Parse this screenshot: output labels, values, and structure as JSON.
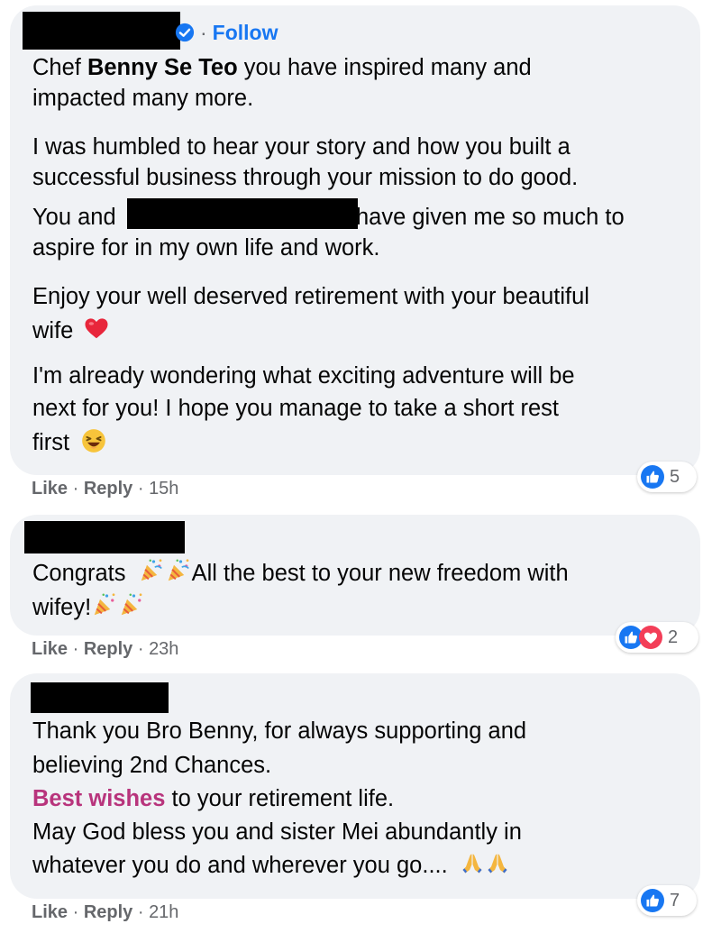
{
  "comments": [
    {
      "follow_label": "Follow",
      "lines": [
        {
          "pre": "Chef ",
          "bold": "Benny Se Teo",
          "post": " you have inspired many and"
        },
        {
          "text": "impacted many more."
        },
        {
          "text": "I was humbled to hear your story and how you built a"
        },
        {
          "text": "successful business through your mission to do good."
        },
        {
          "pre": "You and",
          "post": "have given me so much to"
        },
        {
          "text": "aspire for in my own life and work."
        },
        {
          "text": "Enjoy your well deserved retirement with your beautiful"
        },
        {
          "text": "wife"
        },
        {
          "text": "I'm already wondering what exciting adventure will be"
        },
        {
          "text": "next for you! I hope you manage to take a short rest"
        },
        {
          "text": "first"
        }
      ],
      "like_label": "Like",
      "reply_label": "Reply",
      "time": "15h",
      "reaction_count": "5"
    },
    {
      "lines": [
        {
          "pre": "Congrats",
          "post": "All the best to your new freedom with"
        },
        {
          "text": "wifey!"
        }
      ],
      "like_label": "Like",
      "reply_label": "Reply",
      "time": "23h",
      "reaction_count": "2"
    },
    {
      "lines": [
        {
          "text": "Thank you Bro Benny, for always supporting and"
        },
        {
          "text": "believing 2nd Chances."
        },
        {
          "highlight": "Best wishes",
          "post": " to your retirement life."
        },
        {
          "text": "May God bless you and sister Mei abundantly in"
        },
        {
          "text": "whatever you do and wherever you go...."
        }
      ],
      "like_label": "Like",
      "reply_label": "Reply",
      "time": "21h",
      "reaction_count": "7"
    }
  ],
  "separator": " · ",
  "colors": {
    "bubble": "#f0f2f5",
    "link_blue": "#1877f2",
    "meta_gray": "#65676b",
    "highlight_pink": "#b8347c",
    "love_red": "#f33e58"
  },
  "icons": [
    "verified-badge-icon",
    "heart-emoji-icon",
    "laughing-emoji-icon",
    "party-popper-icon",
    "praying-hands-icon",
    "like-reaction-icon",
    "love-reaction-icon"
  ]
}
